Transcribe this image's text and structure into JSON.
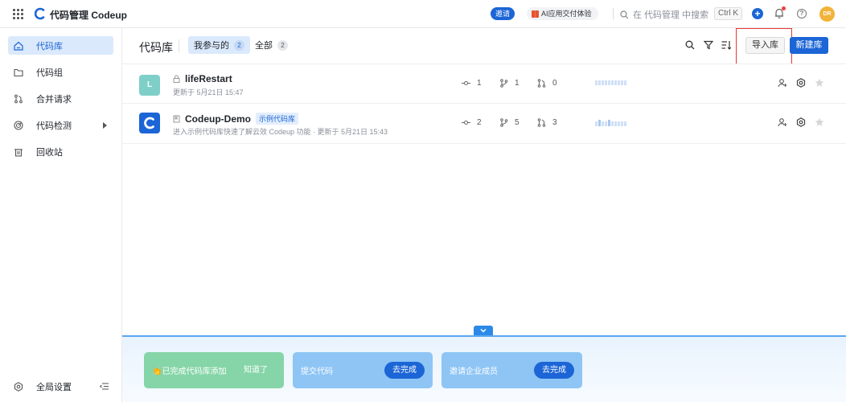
{
  "header": {
    "title": "代码管理 Codeup",
    "invite_label": "邀请",
    "ai_label": "AI应用交付体验",
    "search_placeholder": "在 代码管理 中搜索",
    "shortcut": "Ctrl K",
    "avatar_initials": "DR",
    "icons": [
      "apps-grid-icon",
      "codeup-logo",
      "gift-icon",
      "search-icon",
      "plus-icon",
      "bell-icon",
      "help-icon"
    ]
  },
  "sidebar": {
    "items": [
      {
        "label": "代码库",
        "icon": "repo-home-icon",
        "active": true
      },
      {
        "label": "代码组",
        "icon": "folder-icon",
        "active": false
      },
      {
        "label": "合并请求",
        "icon": "merge-request-icon",
        "active": false
      },
      {
        "label": "代码检测",
        "icon": "scan-icon",
        "active": false
      },
      {
        "label": "回收站",
        "icon": "trash-icon",
        "active": false
      }
    ],
    "bottom_label": "全局设置"
  },
  "main": {
    "title": "代码库",
    "tabs": [
      {
        "label": "我参与的",
        "count": "2",
        "active": true
      },
      {
        "label": "全部",
        "count": "2",
        "active": false
      }
    ],
    "import_label": "导入库",
    "new_label": "新建库"
  },
  "repos": [
    {
      "avatar": "L",
      "avatar_color": "#7ecfc8",
      "name": "lifeRestart",
      "tag": "",
      "meta": "更新于 5月21日 15:47",
      "commits": "1",
      "branches": "1",
      "merge_requests": "0"
    },
    {
      "avatar": "C",
      "avatar_color": "#1b65d6",
      "name": "Codeup-Demo",
      "tag": "示例代码库",
      "meta": "进入示例代码库快速了解云效 Codeup 功能 · 更新于 5月21日 15:43",
      "commits": "2",
      "branches": "5",
      "merge_requests": "3"
    }
  ],
  "tasks": [
    {
      "label": "👏已完成代码库添加",
      "action": "知道了",
      "color": "#86d5a8"
    },
    {
      "label": "提交代码",
      "action": "去完成",
      "color": "#8ec5f5"
    },
    {
      "label": "邀请企业成员",
      "action": "去完成",
      "color": "#8ec5f5"
    }
  ],
  "colors": {
    "accent": "#1b65d6",
    "active_bg": "#dbe9fc",
    "highlight_border": "#e53935"
  }
}
